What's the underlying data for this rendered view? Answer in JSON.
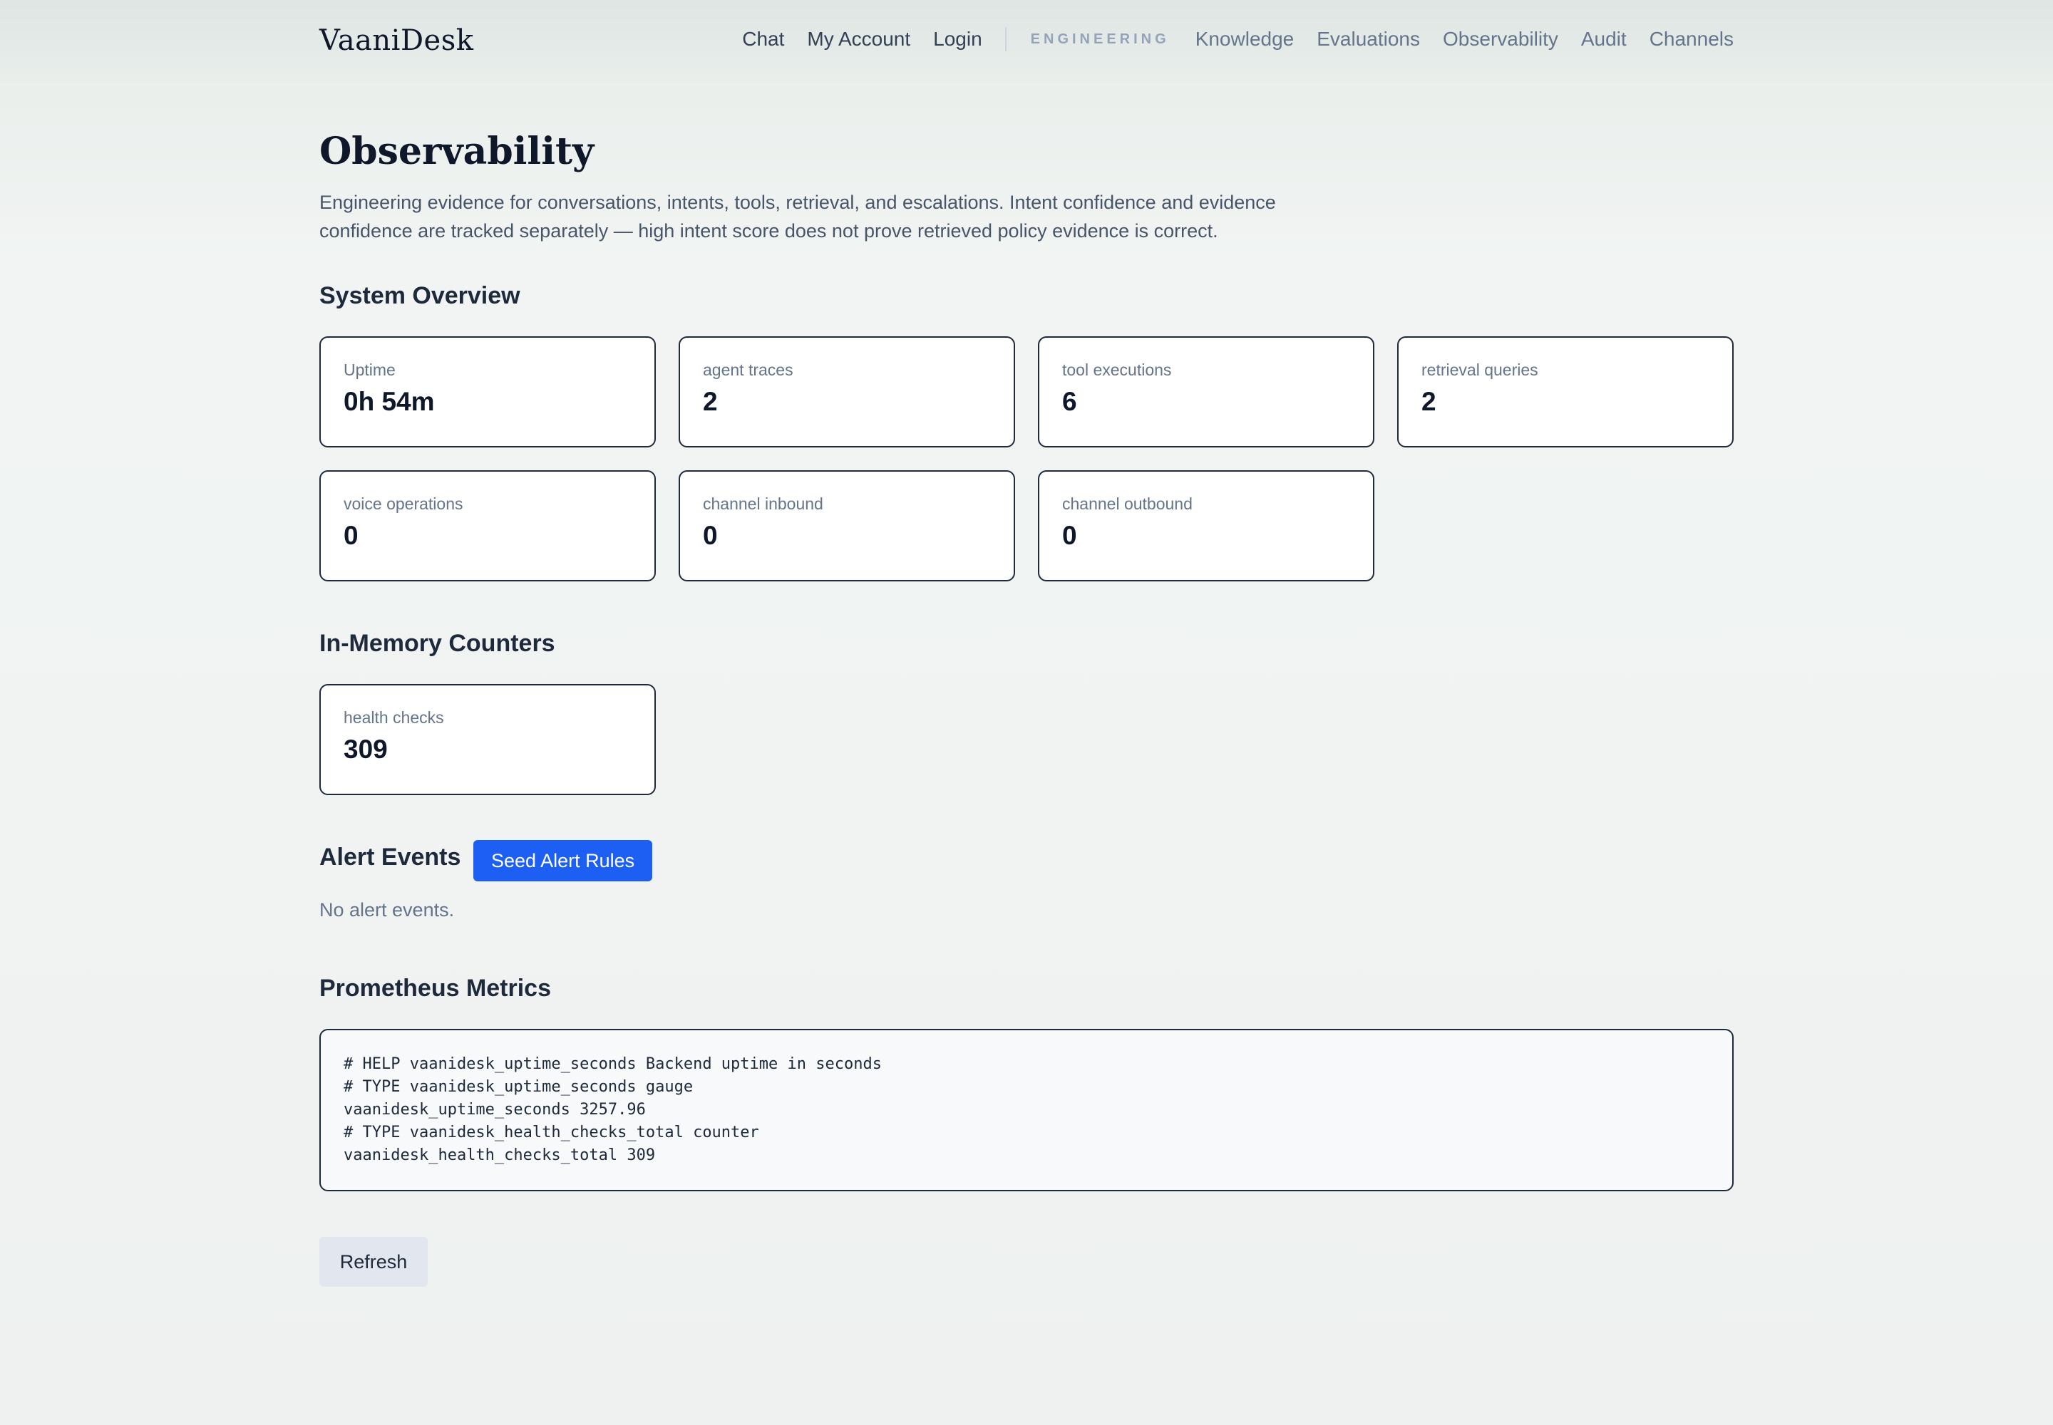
{
  "header": {
    "brand": "VaaniDesk",
    "nav_main": [
      "Chat",
      "My Account",
      "Login"
    ],
    "section_label": "ENGINEERING",
    "nav_engineering": [
      "Knowledge",
      "Evaluations",
      "Observability",
      "Audit",
      "Channels"
    ]
  },
  "page": {
    "title": "Observability",
    "description": "Engineering evidence for conversations, intents, tools, retrieval, and escalations. Intent confidence and evidence confidence are tracked separately — high intent score does not prove retrieved policy evidence is correct."
  },
  "system_overview": {
    "heading": "System Overview",
    "cards": [
      {
        "label": "Uptime",
        "value": "0h 54m"
      },
      {
        "label": "agent traces",
        "value": "2"
      },
      {
        "label": "tool executions",
        "value": "6"
      },
      {
        "label": "retrieval queries",
        "value": "2"
      },
      {
        "label": "voice operations",
        "value": "0"
      },
      {
        "label": "channel inbound",
        "value": "0"
      },
      {
        "label": "channel outbound",
        "value": "0"
      }
    ]
  },
  "in_memory": {
    "heading": "In-Memory Counters",
    "cards": [
      {
        "label": "health checks",
        "value": "309"
      }
    ]
  },
  "alerts": {
    "heading": "Alert Events",
    "seed_button": "Seed Alert Rules",
    "empty_text": "No alert events."
  },
  "prometheus": {
    "heading": "Prometheus Metrics",
    "text": "# HELP vaanidesk_uptime_seconds Backend uptime in seconds\n# TYPE vaanidesk_uptime_seconds gauge\nvaanidesk_uptime_seconds 3257.96\n# TYPE vaanidesk_health_checks_total counter\nvaanidesk_health_checks_total 309"
  },
  "refresh_button": "Refresh",
  "colors": {
    "primary": "#1d5ff3",
    "card_border": "#1e293b",
    "muted_text": "#64748b"
  }
}
